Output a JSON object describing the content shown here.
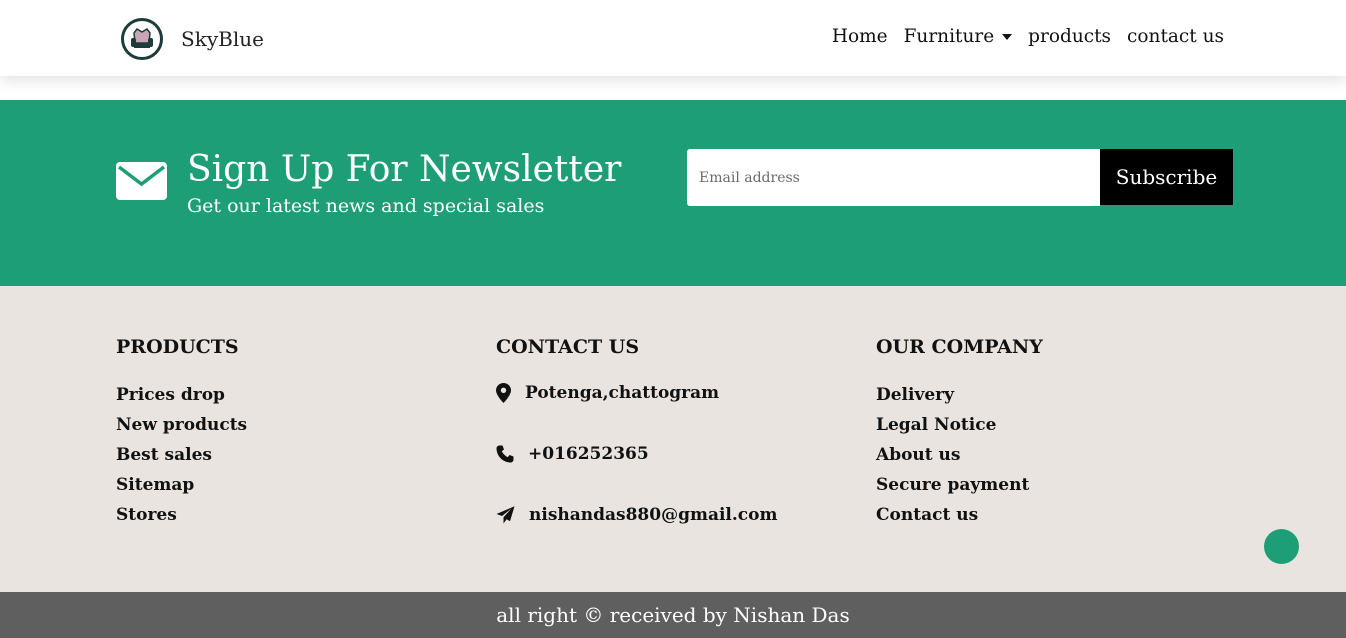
{
  "navbar": {
    "brand": "SkyBlue",
    "links": [
      {
        "label": "Home"
      },
      {
        "label": "Furniture"
      },
      {
        "label": "products"
      },
      {
        "label": "contact us"
      }
    ]
  },
  "newsletter": {
    "title": "Sign Up For Newsletter",
    "subtitle": "Get our latest news and special sales",
    "email_placeholder": "Email address",
    "button_label": "Subscribe",
    "background_color": "#1e9e76"
  },
  "footer": {
    "products": {
      "heading": "PRODUCTS",
      "items": [
        "Prices drop",
        "New products",
        "Best sales",
        "Sitemap",
        "Stores"
      ]
    },
    "contact": {
      "heading": "CONTACT US",
      "address": "Potenga,chattogram",
      "phone": "+016252365",
      "email": "nishandas880@gmail.com"
    },
    "company": {
      "heading": "OUR COMPANY",
      "items": [
        "Delivery",
        "Legal Notice",
        "About us",
        "Secure payment",
        "Contact us"
      ]
    },
    "background_color": "#e9e4df"
  },
  "copyright": "all right © received by Nishan Das"
}
